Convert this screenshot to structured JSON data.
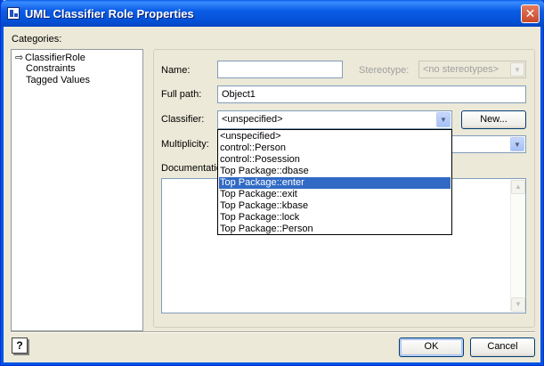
{
  "window": {
    "title": "UML Classifier Role Properties",
    "close_glyph": "✕"
  },
  "categories": {
    "label": "Categories:",
    "items": [
      {
        "label": "ClassifierRole",
        "selected": true
      },
      {
        "label": "Constraints",
        "selected": false
      },
      {
        "label": "Tagged Values",
        "selected": false
      }
    ]
  },
  "form": {
    "name_label": "Name:",
    "name_value": "",
    "stereotype_label": "Stereotype:",
    "stereotype_value": "<no stereotypes>",
    "fullpath_label": "Full path:",
    "fullpath_value": "Object1",
    "classifier_label": "Classifier:",
    "classifier_value": "<unspecified>",
    "new_button": "New...",
    "multiplicity_label": "Multiplicity:",
    "multiplicity_value": "",
    "documentation_label": "Documentation:",
    "documentation_value": ""
  },
  "classifier_dropdown": {
    "options": [
      "<unspecified>",
      "control::Person",
      "control::Posession",
      "Top Package::dbase",
      "Top Package::enter",
      "Top Package::exit",
      "Top Package::kbase",
      "Top Package::lock",
      "Top Package::Person"
    ],
    "selected_index": 4
  },
  "buttons": {
    "ok": "OK",
    "cancel": "Cancel",
    "help": "?"
  },
  "icons": {
    "app": "uml-app-icon",
    "close": "close-icon",
    "tree_arrow": "arrow-right-icon",
    "help": "help-icon",
    "dropdown": "chevron-down-icon"
  },
  "colors": {
    "titlebar": "#0054e3",
    "selection": "#316ac5",
    "face": "#ece9d8"
  }
}
